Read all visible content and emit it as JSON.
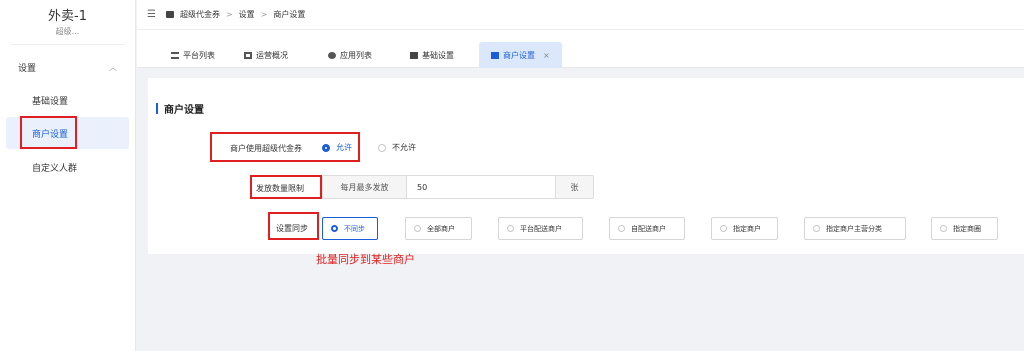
{
  "sidebar": {
    "app_title": "外卖-1",
    "app_subtitle": "超级...",
    "group_label": "设置",
    "items": [
      {
        "label": "基础设置"
      },
      {
        "label": "商户设置"
      },
      {
        "label": "自定义人群"
      }
    ]
  },
  "topbar": {
    "breadcrumb": [
      "超级代金券",
      "设置",
      "商户设置"
    ],
    "separator": ">"
  },
  "tabs": [
    {
      "label": "平台列表"
    },
    {
      "label": "运营概况"
    },
    {
      "label": "应用列表"
    },
    {
      "label": "基础设置"
    },
    {
      "label": "商户设置",
      "close": "×"
    }
  ],
  "panel": {
    "title": "商户设置",
    "allow_row": {
      "label": "商户使用超级代金券",
      "options": [
        "允许",
        "不允许"
      ],
      "selected": "允许"
    },
    "limit_row": {
      "label": "发放数量限制",
      "prefix": "每月最多发放",
      "value": "50",
      "suffix": "张"
    },
    "sync_row": {
      "label": "设置同步",
      "options": [
        "不同步",
        "全部商户",
        "平台配送商户",
        "自配送商户",
        "指定商户",
        "指定商户主营分类",
        "指定商圈"
      ],
      "selected": "不同步"
    },
    "annotation": "批量同步到某些商户"
  },
  "colors": {
    "accent": "#1b5fd6",
    "highlight": "#e02020"
  }
}
